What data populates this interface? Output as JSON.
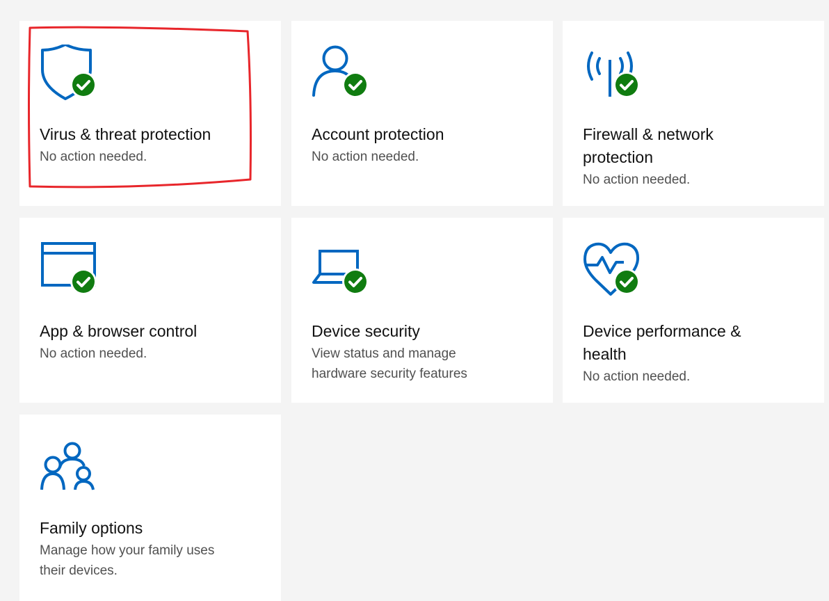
{
  "accent_color": "#0067c0",
  "check_color": "#107c10",
  "tiles": [
    {
      "id": "virus",
      "icon": "shield-icon",
      "title": "Virus & threat protection",
      "status": "No action needed."
    },
    {
      "id": "account",
      "icon": "person-icon",
      "title": "Account protection",
      "status": "No action needed."
    },
    {
      "id": "firewall",
      "icon": "wireless-antenna-icon",
      "title": "Firewall & network protection",
      "status": "No action needed."
    },
    {
      "id": "app",
      "icon": "browser-window-icon",
      "title": "App & browser control",
      "status": "No action needed."
    },
    {
      "id": "device-security",
      "icon": "laptop-icon",
      "title": "Device security",
      "status": "View status and manage hardware security features"
    },
    {
      "id": "performance",
      "icon": "heart-pulse-icon",
      "title": "Device performance & health",
      "status": "No action needed."
    },
    {
      "id": "family",
      "icon": "family-icon",
      "title": "Family options",
      "status": "Manage how your family uses their devices."
    }
  ]
}
